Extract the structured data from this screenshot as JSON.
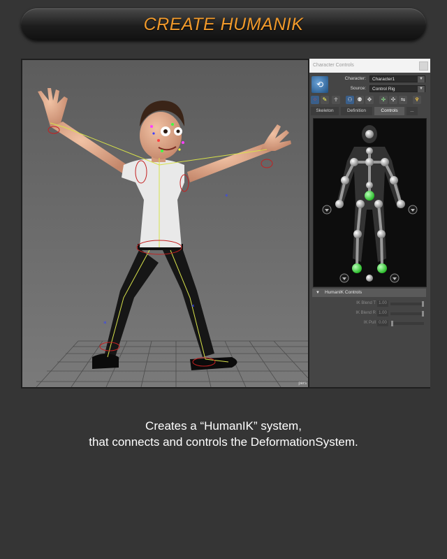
{
  "title": "CREATE HUMANIK",
  "viewport": {
    "camera_label": "pers"
  },
  "panel": {
    "header": "Character Controls",
    "character_label": "Character:",
    "character_value": "Character1",
    "source_label": "Source:",
    "source_value": "Control Rig",
    "tabs": [
      "Skeleton",
      "Definition",
      "Controls",
      "..."
    ],
    "active_tab": "Controls",
    "section_title": "HumanIK Controls",
    "sliders": [
      {
        "label": "IK Blend T",
        "value": "1.00",
        "level": 1.0
      },
      {
        "label": "IK Blend R",
        "value": "1.00",
        "level": 1.0
      },
      {
        "label": "IK Pull",
        "value": "0.00",
        "level": 0.0
      }
    ]
  },
  "caption": {
    "line1": "Creates a “HumanIK” system,",
    "line2": "that connects and controls the DeformationSystem."
  },
  "colors": {
    "title": "#f19a2c",
    "background": "#353535",
    "active_effector": "#33d633"
  }
}
